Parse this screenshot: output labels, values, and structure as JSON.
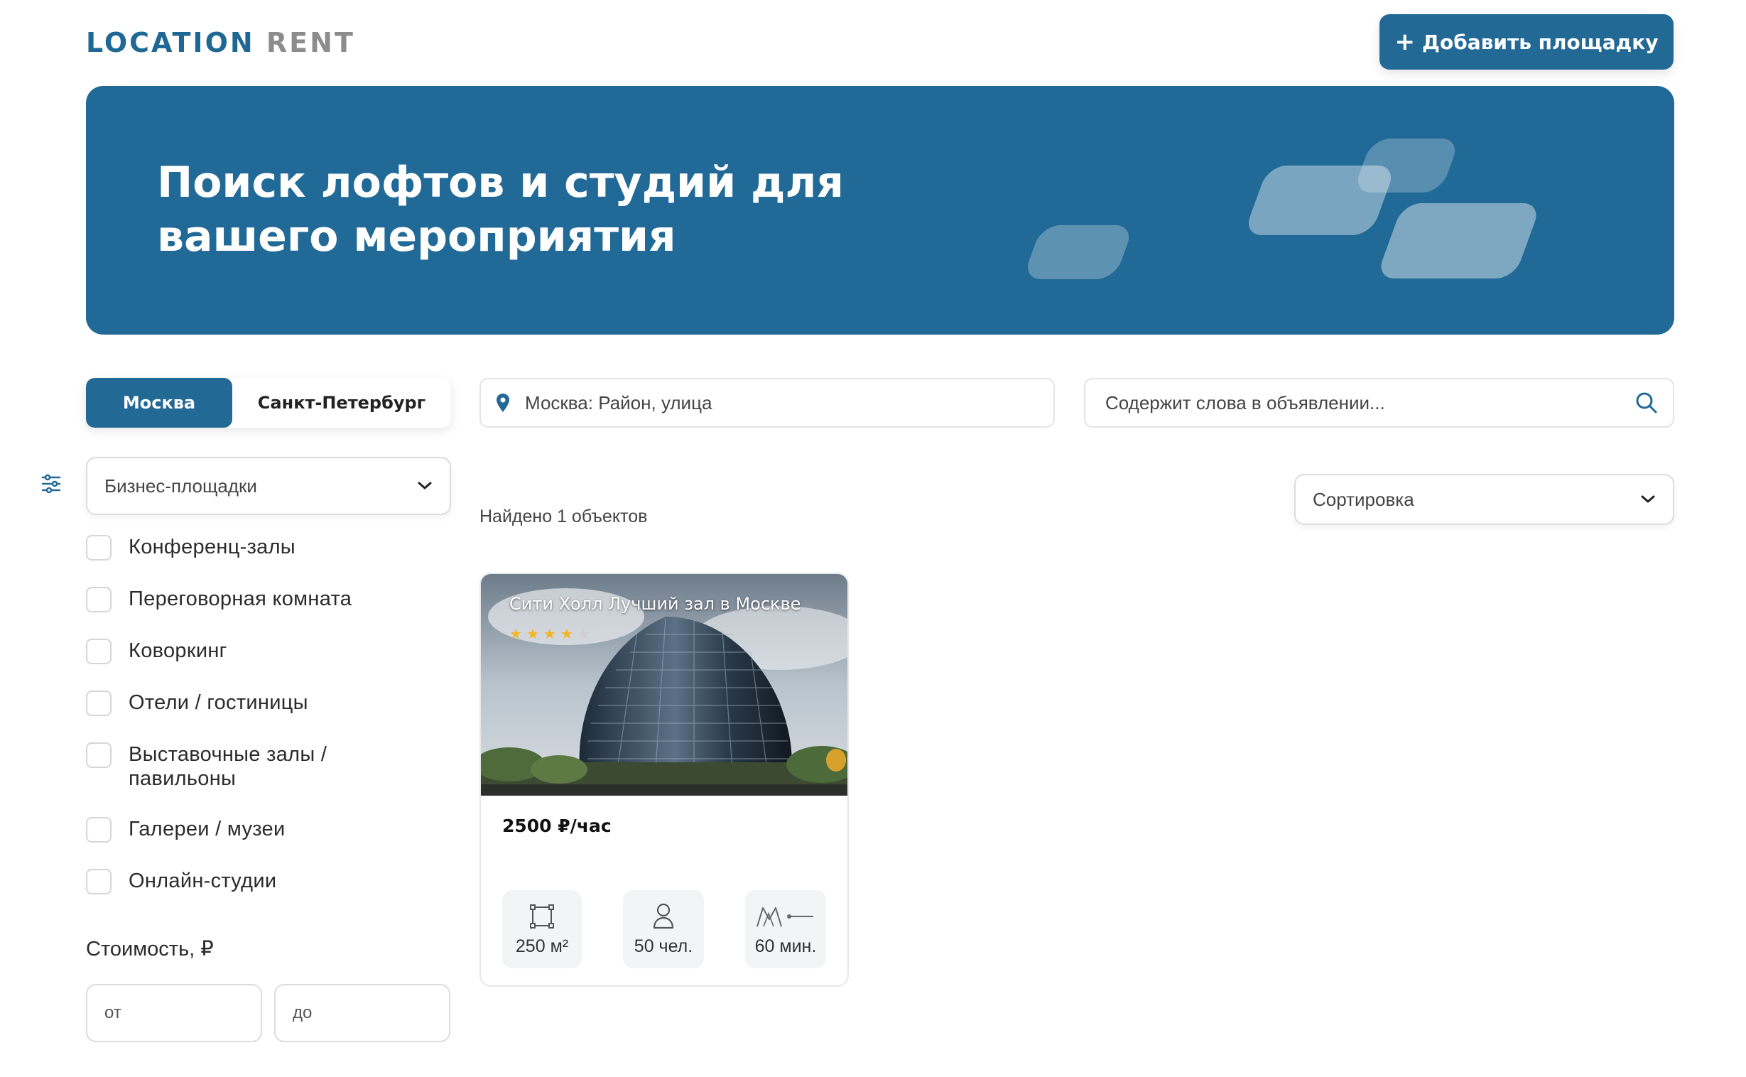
{
  "header": {
    "logo_part1": "LOCATION",
    "logo_part2": "RENT",
    "add_button_label": "Добавить площадку"
  },
  "banner": {
    "title_line1": "Поиск лофтов и студий для",
    "title_line2": "вашего мероприятия"
  },
  "cities": {
    "active": "Москва",
    "inactive": "Санкт-Петербург"
  },
  "search": {
    "location_placeholder": "Москва: Район, улица",
    "keywords_placeholder": "Содержит слова в объявлении..."
  },
  "filters": {
    "category_selected": "Бизнес-площадки",
    "categories": [
      {
        "label": "Конференц-залы",
        "checked": false
      },
      {
        "label": "Переговорная комната",
        "checked": false
      },
      {
        "label": "Коворкинг",
        "checked": false
      },
      {
        "label": "Отели / гостиницы",
        "checked": false
      },
      {
        "label": "Выставочные залы / павильоны",
        "checked": false
      },
      {
        "label": "Галереи / музеи",
        "checked": false
      },
      {
        "label": "Онлайн-студии",
        "checked": false
      }
    ],
    "price_label": "Стоимость, ₽",
    "price_from_placeholder": "от",
    "price_to_placeholder": "до"
  },
  "results": {
    "found_text": "Найдено 1 объектов",
    "sort_label": "Сортировка",
    "cards": [
      {
        "title": "Сити Холл Лучший зал в Москве",
        "rating": 4,
        "rating_max": 5,
        "price": "2500 ₽/час",
        "area": "250 м²",
        "capacity": "50 чел.",
        "metro_time": "60 мин."
      }
    ]
  },
  "colors": {
    "primary": "#226996",
    "logo_gray": "#8c8c8c",
    "star": "#f4b521"
  },
  "icons": {
    "add": "plus-icon",
    "location": "map-pin-icon",
    "search": "search-icon",
    "filter": "sliders-icon",
    "dropdown": "chevron-down-icon",
    "area": "square-area-icon",
    "capacity": "person-icon",
    "metro": "metro-walk-icon"
  }
}
